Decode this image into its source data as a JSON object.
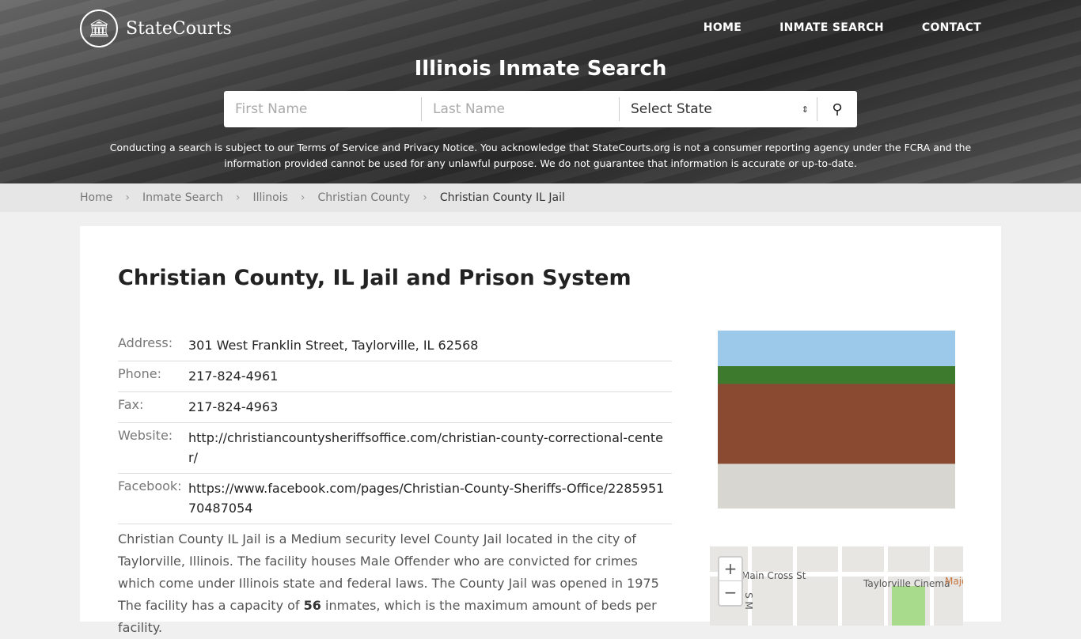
{
  "brand": "StateCourts",
  "nav": [
    "HOME",
    "INMATE SEARCH",
    "CONTACT"
  ],
  "hero_title": "Illinois Inmate Search",
  "search": {
    "first_placeholder": "First Name",
    "last_placeholder": "Last Name",
    "state_value": "Select State"
  },
  "disclaimer": {
    "p1": "Conducting a search is subject to our ",
    "tos": "Terms of Service",
    "p2": " and ",
    "privacy": "Privacy Notice",
    "p3": ". You acknowledge that StateCourts.org is not a consumer reporting agency under the FCRA and the information provided cannot be used for any unlawful purpose. We do not guarantee that information is accurate or up-to-date."
  },
  "breadcrumb": [
    "Home",
    "Inmate Search",
    "Illinois",
    "Christian County",
    "Christian County IL Jail"
  ],
  "page_title": "Christian County, IL Jail and Prison System",
  "info": [
    {
      "label": "Address:",
      "value": "301 West Franklin Street, Taylorville, IL 62568"
    },
    {
      "label": "Phone:",
      "value": "217-824-4961"
    },
    {
      "label": "Fax:",
      "value": "217-824-4963"
    },
    {
      "label": "Website:",
      "value": "http://christiancountysheriffsoffice.com/christian-county-correctional-center/",
      "link": true
    },
    {
      "label": "Facebook:",
      "value": "https://www.facebook.com/pages/Christian-County-Sheriffs-Office/228595170487054",
      "link": true
    }
  ],
  "description": {
    "p1": "Christian County IL Jail is a Medium security level County Jail located in the city of Taylorville, Illinois. The facility houses Male Offender who are convicted for crimes which come under Illinois state and federal laws. The County Jail was opened in 1975 The facility has a capacity of ",
    "capacity": "56",
    "p2": " inmates, which is the maximum amount of beds per facility."
  },
  "map": {
    "labels": [
      "Main Cross St",
      "Taylorville Cinema",
      "Majo",
      "S M"
    ],
    "zoom_in": "+",
    "zoom_out": "−"
  }
}
